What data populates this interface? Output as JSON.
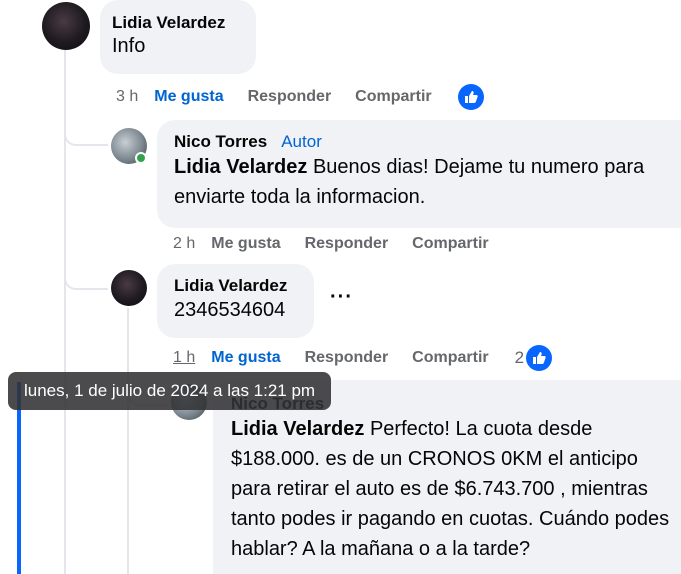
{
  "comments": [
    {
      "author": "Lidia Velardez",
      "text": "Info",
      "time": "3 h",
      "like_label": "Me gusta",
      "reply_label": "Responder",
      "share_label": "Compartir",
      "reaction_count": ""
    },
    {
      "author": "Nico Torres",
      "badge": "Autor",
      "mention": "Lidia Velardez",
      "text": " Buenos dias! Dejame tu numero para enviarte toda la informacion.",
      "time": "2 h",
      "like_label": "Me gusta",
      "reply_label": "Responder",
      "share_label": "Compartir"
    },
    {
      "author": "Lidia Velardez",
      "text": "2346534604",
      "more_label": "···",
      "time": "1 h",
      "like_label": "Me gusta",
      "reply_label": "Responder",
      "share_label": "Compartir",
      "reaction_count": "2"
    },
    {
      "author": "Nico Torres",
      "mention": "Lidia Velardez",
      "text": " Perfecto! La cuota desde $188.000. es de un CRONOS 0KM el anticipo para retirar el auto es de $6.743.700 , mientras tanto podes ir pagando en cuotas. Cuándo podes hablar? A la mañana o a la tarde?"
    }
  ],
  "tooltip": "lunes, 1 de julio de 2024 a las 1:21 pm",
  "colors": {
    "link_blue": "#0064d1",
    "like_blue": "#0866ff",
    "bubble_bg": "#f0f2f5",
    "meta_gray": "#65676b",
    "online_green": "#31a24c"
  },
  "icons": [
    "like-thumb-icon",
    "online-status-icon",
    "more-options-icon"
  ]
}
